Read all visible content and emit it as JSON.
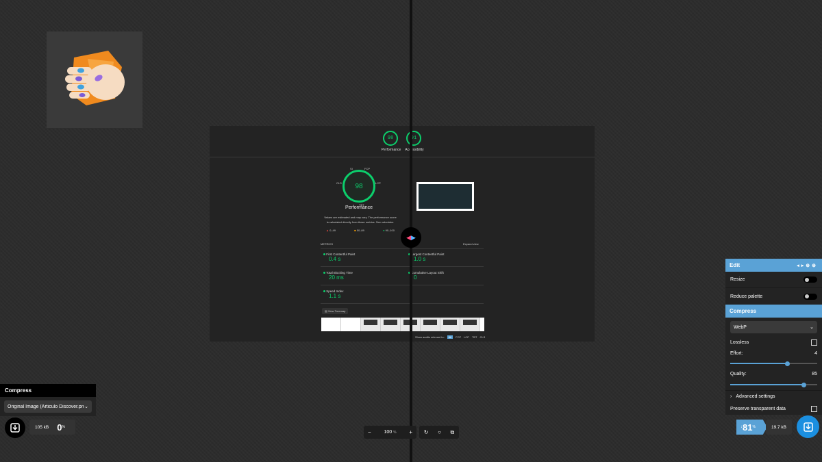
{
  "preview": {
    "gauges": [
      {
        "score": "98",
        "label": "Performance"
      },
      {
        "score": "91",
        "label": "Accessibility"
      }
    ],
    "main_score": "98",
    "main_label": "Performance",
    "gauge_labels": {
      "si": "SI",
      "fcp": "FCP",
      "lcp": "LCP",
      "tbt": "TBT",
      "cls": "CLS"
    },
    "desc_line1": "Values are estimated and may vary. The performance score",
    "desc_line2": "is calculated directly from these metrics. See calculator.",
    "legend": [
      {
        "range": "0–49",
        "color": "#ff4e42"
      },
      {
        "range": "50–89",
        "color": "#ffa400"
      },
      {
        "range": "90–100",
        "color": "#0cce6b"
      }
    ],
    "metrics_label": "METRICS",
    "expand_label": "Expand view",
    "metrics_left": [
      {
        "name": "First Contentful Paint",
        "value": "0.4 s"
      },
      {
        "name": "Total Blocking Time",
        "value": "20 ms"
      },
      {
        "name": "Speed Index",
        "value": "1.1 s"
      }
    ],
    "metrics_right": [
      {
        "name": "Largest Contentful Paint",
        "value": "1.0 s"
      },
      {
        "name": "Cumulative Layout Shift",
        "value": "0"
      }
    ],
    "treemap_label": "View Treemap",
    "audits_label": "Show audits relevant to:",
    "audit_tags": [
      "All",
      "FCP",
      "LCP",
      "TBT",
      "CLS"
    ]
  },
  "left_panel": {
    "title": "Compress",
    "select_value": "Original Image (Articulo Discover.png)",
    "size": "105 kB",
    "percent": "0",
    "percent_unit": "%"
  },
  "zoom": {
    "minus": "−",
    "value": "100",
    "unit": "%",
    "plus": "+"
  },
  "right_panel": {
    "edit_title": "Edit",
    "resize_label": "Resize",
    "resize_on": false,
    "reduce_label": "Reduce palette",
    "reduce_on": false,
    "compress_title": "Compress",
    "format": "WebP",
    "lossless_label": "Lossless",
    "lossless_checked": false,
    "effort_label": "Effort:",
    "effort_value": "4",
    "effort_fraction": 0.66,
    "quality_label": "Quality:",
    "quality_value": "85",
    "quality_fraction": 0.85,
    "advanced_label": "Advanced settings",
    "preserve_label": "Preserve transparent data",
    "preserve_checked": false,
    "percent": "81",
    "percent_dir": "↓",
    "percent_unit": "%",
    "size": "19.7 kB"
  },
  "colors": {
    "accent": "#5aa2d6",
    "download_left": "#000000",
    "download_right": "#1b8fe0",
    "good": "#0cce6b"
  }
}
